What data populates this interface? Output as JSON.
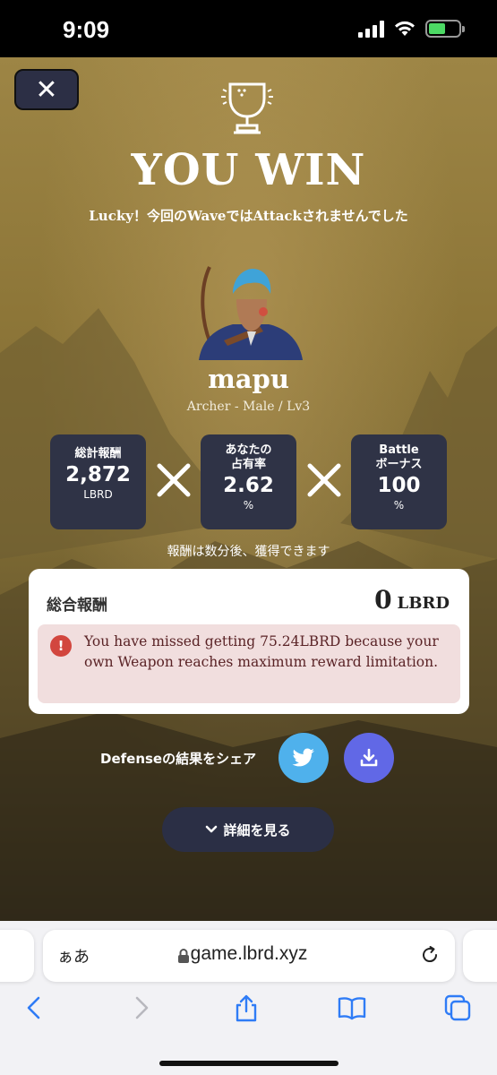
{
  "status": {
    "time": "9:09"
  },
  "game": {
    "close_label": "✕",
    "title": "YOU WIN",
    "subtitle": "Lucky！今回のWaveではAttackされませんでした",
    "player": {
      "name": "mapu",
      "class_info": "Archer - Male / Lv3"
    },
    "stats": [
      {
        "label": "総計報酬",
        "value": "2,872",
        "unit": "LBRD"
      },
      {
        "label": "あなたの\n占有率",
        "value": "2.62",
        "unit": "%"
      },
      {
        "label": "Battle\nボーナス",
        "value": "100",
        "unit": "%"
      }
    ],
    "notice": "報酬は数分後、獲得できます",
    "reward": {
      "label": "総合報酬",
      "amount": "0",
      "unit": "LBRD",
      "warning": "You have missed getting 75.24LBRD because your own Weapon reaches maximum reward limitation."
    },
    "share_label": "Defenseの結果をシェア",
    "detail_button": "詳細を見る"
  },
  "browser": {
    "aa_label": "ぁあ",
    "url": "game.lbrd.xyz"
  }
}
